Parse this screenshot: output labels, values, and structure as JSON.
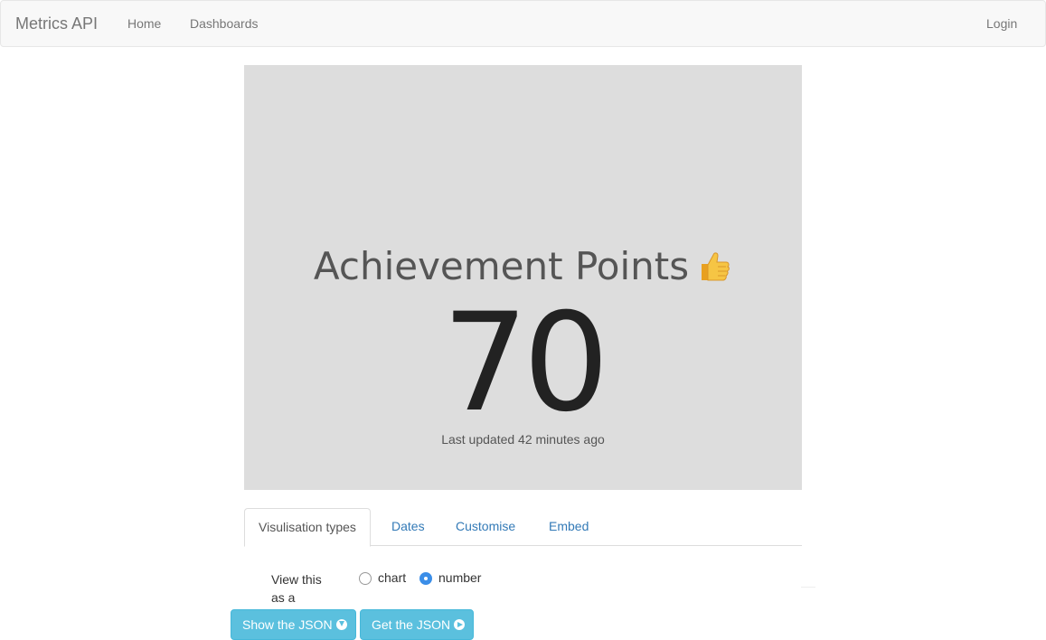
{
  "navbar": {
    "brand": "Metrics API",
    "links": [
      "Home",
      "Dashboards"
    ],
    "login": "Login"
  },
  "metric": {
    "title": "Achievement Points",
    "emoji_icon": "thumbs-up-icon",
    "value": "70",
    "updated": "Last updated 42 minutes ago"
  },
  "tabs": [
    {
      "label": "Visulisation types",
      "active": true
    },
    {
      "label": "Dates",
      "active": false
    },
    {
      "label": "Customise",
      "active": false
    },
    {
      "label": "Embed",
      "active": false
    }
  ],
  "options": {
    "view_label": "View this as a",
    "choices": [
      {
        "label": "chart",
        "checked": false
      },
      {
        "label": "number",
        "checked": true
      }
    ]
  },
  "buttons": {
    "show_json": "Show the JSON",
    "get_json": "Get the JSON"
  },
  "colors": {
    "panel_bg": "#dddddd",
    "button": "#5bc0de",
    "link": "#337ab7",
    "radio_checked": "#3b8ee8"
  }
}
